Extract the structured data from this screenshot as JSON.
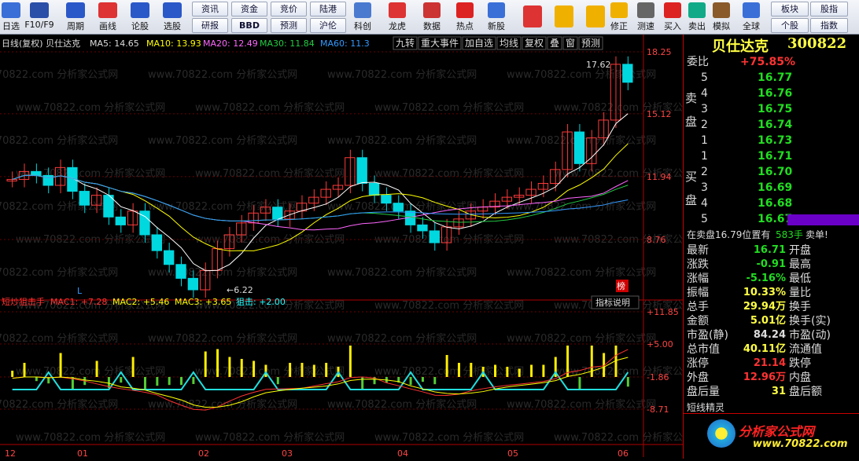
{
  "toolbar": {
    "main": [
      {
        "label": "日选"
      },
      {
        "label": "F10/F9"
      },
      {
        "label": "周期"
      },
      {
        "label": "画线"
      },
      {
        "label": "论股"
      },
      {
        "label": "选股"
      }
    ],
    "small_top": [
      "资讯",
      "资金",
      "竞价",
      "陆港"
    ],
    "small_bottom": [
      "研报",
      "BBD",
      "预测",
      "沪伦"
    ],
    "right": [
      {
        "label": "科创"
      },
      {
        "label": "龙虎"
      },
      {
        "label": "数据"
      },
      {
        "label": "热点"
      },
      {
        "label": "新股"
      },
      {
        "label": "修正"
      },
      {
        "label": "测速"
      },
      {
        "label": "买入"
      },
      {
        "label": "卖出"
      },
      {
        "label": "模拟"
      },
      {
        "label": "全球"
      }
    ],
    "right_small_top": [
      "板块",
      "股指"
    ],
    "right_small_bottom": [
      "个股",
      "指数"
    ]
  },
  "main_chart": {
    "header": "日线(复权) 贝仕达克",
    "ma5": "MA5: 14.65",
    "ma10": "MA10: 13.93",
    "ma20": "MA20: 12.49",
    "ma30": "MA30: 11.84",
    "ma60": "MA60: 11.3",
    "buttons": [
      "九转",
      "重大事件",
      "加自选",
      "均线",
      "复权",
      "叠",
      "窗",
      "预测"
    ],
    "price_axis": [
      "18.25",
      "15.12",
      "11.94",
      "8.76"
    ],
    "high_label": "17.62",
    "low_label": "6.22",
    "l_marker": "L",
    "bang": "榜"
  },
  "sub_chart": {
    "title": "短炒狙击手",
    "mac1": "MAC1: +7.28",
    "mac2": "MAC2: +5.46",
    "mac3": "MAC3: +3.65",
    "jj": "狙击: +2.00",
    "btn": "指标说明",
    "axis": [
      "+11.85",
      "+5.00",
      "-1.86",
      "-8.71"
    ]
  },
  "x_axis": [
    "12",
    "01",
    "02",
    "03",
    "04",
    "05",
    "06"
  ],
  "watermark": "www.70822.com 分析家公式网",
  "quote": {
    "name": "贝仕达克",
    "code": "300822",
    "weibi_label": "委比",
    "weibi": "+75.85%",
    "sell_label": "卖盘",
    "buy_label": "买盘",
    "sells": [
      {
        "n": "5",
        "p": "16.77"
      },
      {
        "n": "4",
        "p": "16.76"
      },
      {
        "n": "3",
        "p": "16.75"
      },
      {
        "n": "2",
        "p": "16.74"
      },
      {
        "n": "1",
        "p": "16.73"
      }
    ],
    "buys": [
      {
        "n": "1",
        "p": "16.71"
      },
      {
        "n": "2",
        "p": "16.70"
      },
      {
        "n": "3",
        "p": "16.69"
      },
      {
        "n": "4",
        "p": "16.68"
      },
      {
        "n": "5",
        "p": "16.67"
      }
    ],
    "ticker": "在卖盘16.79位置有",
    "ticker_vol": "583手",
    "ticker_end": "卖单!",
    "stats": [
      {
        "l": "最新",
        "v": "16.71",
        "c": "g",
        "l2": "开盘"
      },
      {
        "l": "涨跌",
        "v": "-0.91",
        "c": "g",
        "l2": "最高"
      },
      {
        "l": "涨幅",
        "v": "-5.16%",
        "c": "g",
        "l2": "最低"
      },
      {
        "l": "振幅",
        "v": "10.33%",
        "c": "y",
        "l2": "量比"
      },
      {
        "l": "总手",
        "v": "29.94万",
        "c": "y",
        "l2": "换手"
      },
      {
        "l": "金额",
        "v": "5.01亿",
        "c": "y",
        "l2": "换手(实)"
      },
      {
        "l": "市盈(静)",
        "v": "84.24",
        "c": "w",
        "l2": "市盈(动)"
      },
      {
        "l": "总市值",
        "v": "40.11亿",
        "c": "y",
        "l2": "流通值"
      },
      {
        "l": "涨停",
        "v": "21.14",
        "c": "r",
        "l2": "跌停"
      },
      {
        "l": "外盘",
        "v": "12.96万",
        "c": "r",
        "l2": "内盘"
      },
      {
        "l": "盘后量",
        "v": "31",
        "c": "y",
        "l2": "盘后额"
      }
    ],
    "elf_title": "短线精灵",
    "logo_text": "分析家公式网",
    "logo_url": "www.70822.com"
  },
  "chart_data": {
    "type": "candlestick",
    "price_range": [
      6.22,
      18.25
    ],
    "close_path": [
      11.8,
      12.2,
      12.0,
      11.5,
      12.4,
      11.2,
      10.5,
      11.0,
      9.9,
      9.5,
      10.2,
      9.0,
      8.2,
      7.5,
      6.8,
      6.22,
      7.2,
      8.3,
      9.0,
      9.6,
      10.1,
      10.4,
      9.8,
      10.2,
      10.6,
      10.9,
      11.3,
      11.5,
      12.9,
      11.6,
      11.0,
      10.6,
      10.2,
      9.5,
      9.2,
      8.6,
      9.4,
      9.8,
      10.2,
      10.4,
      10.7,
      10.9,
      11.0,
      11.3,
      11.6,
      12.3,
      14.2,
      12.6,
      13.9,
      14.8,
      17.62,
      16.71
    ],
    "colors": {
      "up": "#ff3b3b",
      "down": "#00d8e0",
      "ma5": "#ffffff",
      "ma10": "#ffff00",
      "ma20": "#ff66ff",
      "ma30": "#22cc44",
      "ma60": "#3399ff"
    }
  }
}
